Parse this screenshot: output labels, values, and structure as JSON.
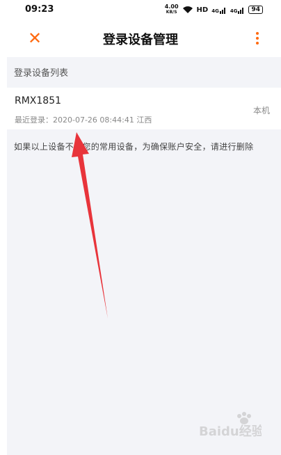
{
  "status_bar": {
    "time": "09:23",
    "net_speed_value": "4.00",
    "net_speed_unit": "KB/S",
    "hd_label": "HD",
    "signal_1": "4G",
    "signal_2": "4G",
    "battery": "94"
  },
  "nav": {
    "close_icon": "close-icon",
    "title": "登录设备管理",
    "more_icon": "more-vertical-icon"
  },
  "section": {
    "header": "登录设备列表"
  },
  "devices": [
    {
      "name": "RMX1851",
      "last_login": "最近登录：2020-07-26 08:44:41 江西",
      "badge": "本机"
    }
  ],
  "hint": "如果以上设备不是您的常用设备，为确保账户安全，请进行删除",
  "watermark": "Baidu经验",
  "colors": {
    "accent": "#ff6a10",
    "background": "#f3f4f8",
    "arrow": "#e8343b"
  }
}
